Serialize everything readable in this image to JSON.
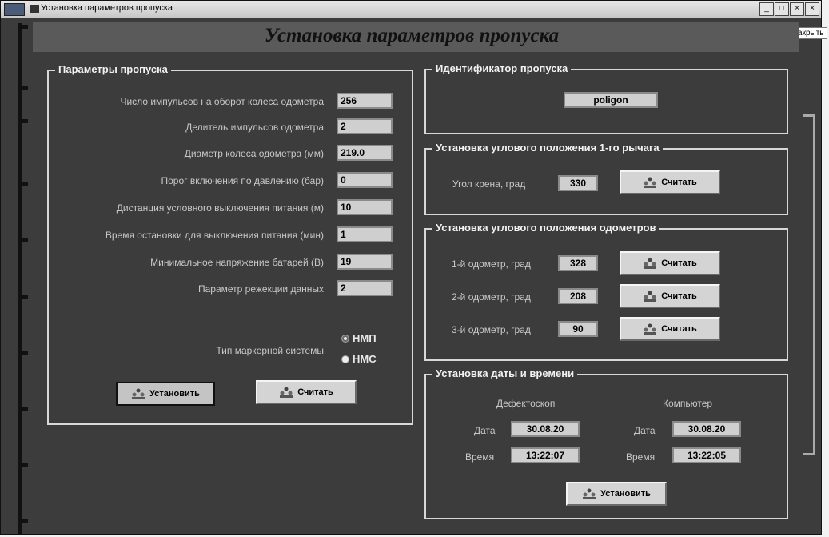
{
  "window": {
    "title": "Установка параметров пропуска",
    "tooltip": "Закрыть",
    "btn_min": "_",
    "btn_max": "□",
    "btn_close": "×",
    "btn_close2": "×"
  },
  "heading": "Установка параметров пропуска",
  "params": {
    "title": "Параметры пропуска",
    "rows": [
      {
        "label": "Число импульсов на оборот колеса одометра",
        "value": "256"
      },
      {
        "label": "Делитель импульсов одометра",
        "value": "2"
      },
      {
        "label": "Диаметр колеса одометра (мм)",
        "value": "219.0"
      },
      {
        "label": "Порог включения по давлению (бар)",
        "value": "0"
      },
      {
        "label": "Дистанция условного выключения питания (м)",
        "value": "10"
      },
      {
        "label": "Время остановки для выключения питания (мин)",
        "value": "1"
      },
      {
        "label": "Минимальное напряжение батарей (В)",
        "value": "19"
      },
      {
        "label": "Параметр режекции данных",
        "value": "2"
      }
    ],
    "marker_label": "Тип маркерной системы",
    "marker_options": [
      "НМП",
      "НМС"
    ],
    "marker_selected": "НМП",
    "set_button": "Установить",
    "read_button": "Считать"
  },
  "identifier": {
    "title": "Идентификатор пропуска",
    "value": "poligon"
  },
  "lever": {
    "title": "Установка углового положения 1-го рычага",
    "label": "Угол крена, град",
    "value": "330",
    "button": "Считать"
  },
  "odometers": {
    "title": "Установка углового положения одометров",
    "rows": [
      {
        "label": "1-й одометр, град",
        "value": "328",
        "button": "Считать"
      },
      {
        "label": "2-й одометр, град",
        "value": "208",
        "button": "Считать"
      },
      {
        "label": "3-й одометр, град",
        "value": "90",
        "button": "Считать"
      }
    ]
  },
  "datetime": {
    "title": "Установка даты и времени",
    "col1_title": "Дефектоскоп",
    "col2_title": "Компьютер",
    "date_label": "Дата",
    "time_label": "Время",
    "defect_date": "30.08.20",
    "defect_time": "13:22:07",
    "pc_date": "30.08.20",
    "pc_time": "13:22:05",
    "button": "Установить"
  },
  "icons": {
    "button_icon": "people-upload-icon",
    "system_icon": "app-icon"
  }
}
